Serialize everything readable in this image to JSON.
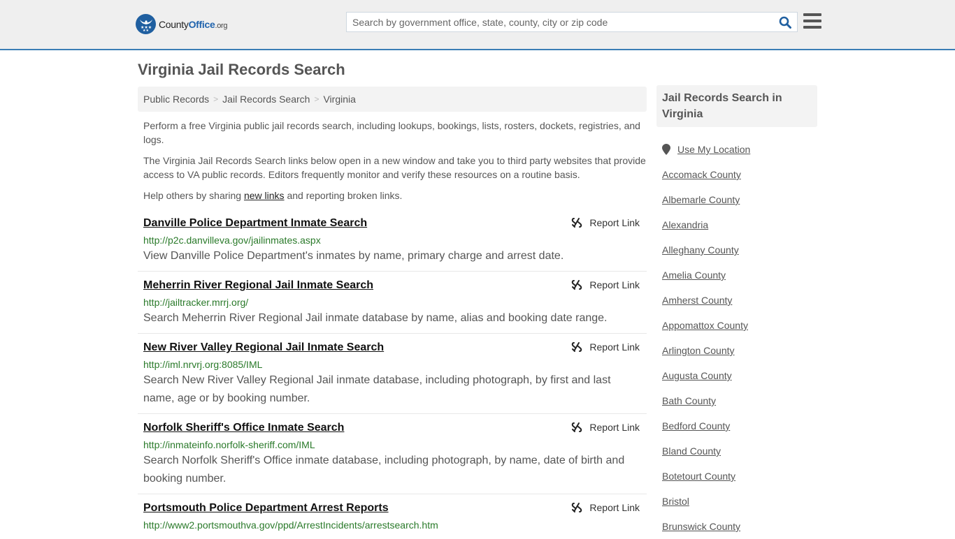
{
  "header": {
    "logo": {
      "name_main": "County",
      "name_accent": "Office",
      "name_suffix": ".org"
    },
    "search": {
      "placeholder": "Search by government office, state, county, city or zip code",
      "value": ""
    },
    "colors": {
      "accent": "#3a7db5",
      "brand_blue": "#1f5fa0"
    }
  },
  "page": {
    "title": "Virginia Jail Records Search"
  },
  "breadcrumb": [
    {
      "label": "Public Records"
    },
    {
      "label": "Jail Records Search"
    },
    {
      "label": "Virginia"
    }
  ],
  "intro": {
    "p1": "Perform a free Virginia public jail records search, including lookups, bookings, lists, rosters, dockets, registries, and logs.",
    "p2": "The Virginia Jail Records Search links below open in a new window and take you to third party websites that provide access to VA public records. Editors frequently monitor and verify these resources on a routine basis.",
    "p3_before": "Help others by sharing ",
    "p3_link": "new links",
    "p3_after": " and reporting broken links."
  },
  "report_label": "Report Link",
  "results": [
    {
      "title": "Danville Police Department Inmate Search",
      "url": "http://p2c.danvilleva.gov/jailinmates.aspx",
      "description": "View Danville Police Department's inmates by name, primary charge and arrest date."
    },
    {
      "title": "Meherrin River Regional Jail Inmate Search",
      "url": "http://jailtracker.mrrj.org/",
      "description": "Search Meherrin River Regional Jail inmate database by name, alias and booking date range."
    },
    {
      "title": "New River Valley Regional Jail Inmate Search",
      "url": "http://iml.nrvrj.org:8085/IML",
      "description": "Search New River Valley Regional Jail inmate database, including photograph, by first and last name, age or by booking number."
    },
    {
      "title": "Norfolk Sheriff's Office Inmate Search",
      "url": "http://inmateinfo.norfolk-sheriff.com/IML",
      "description": "Search Norfolk Sheriff's Office inmate database, including photograph, by name, date of birth and booking number."
    },
    {
      "title": "Portsmouth Police Department Arrest Reports",
      "url": "http://www2.portsmouthva.gov/ppd/ArrestIncidents/arrestsearch.htm",
      "description": ""
    }
  ],
  "sidebar": {
    "heading": "Jail Records Search in Virginia",
    "use_location": "Use My Location",
    "items": [
      "Accomack County",
      "Albemarle County",
      "Alexandria",
      "Alleghany County",
      "Amelia County",
      "Amherst County",
      "Appomattox County",
      "Arlington County",
      "Augusta County",
      "Bath County",
      "Bedford County",
      "Bland County",
      "Botetourt County",
      "Bristol",
      "Brunswick County"
    ]
  }
}
